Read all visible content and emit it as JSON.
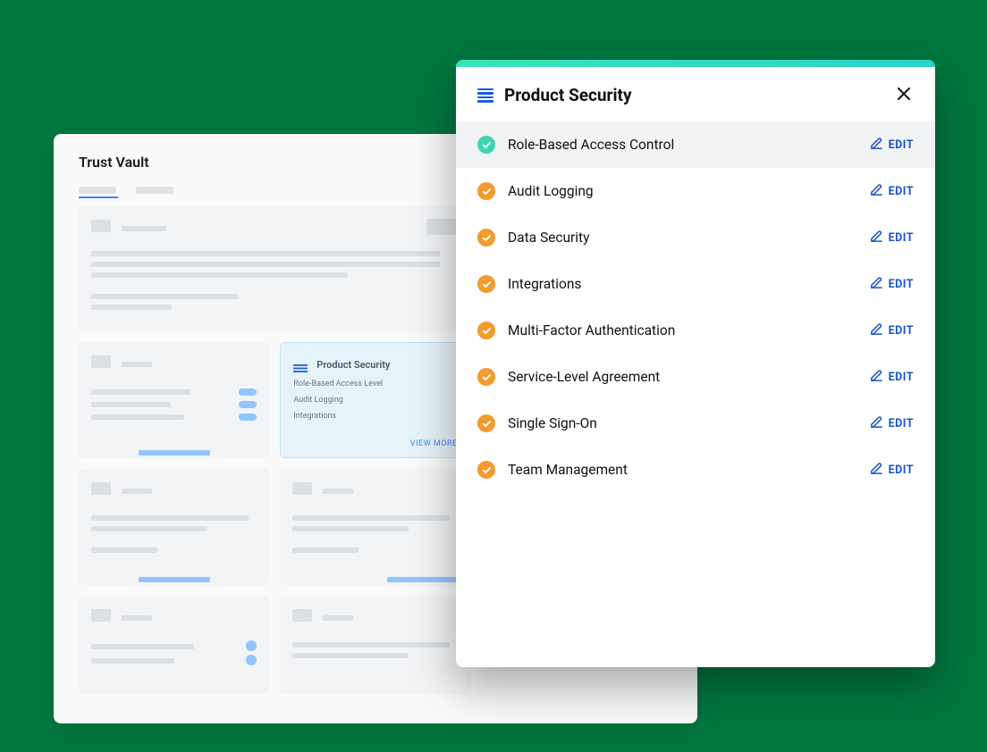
{
  "background": {
    "title": "Trust Vault",
    "product_security_card": {
      "title": "Product Security",
      "lines": [
        "Role-Based Access Level",
        "Audit Logging",
        "Integrations"
      ],
      "view_more": "VIEW MORE"
    }
  },
  "panel": {
    "title": "Product Security",
    "edit_label": "EDIT",
    "items": [
      {
        "label": "Role-Based Access Control",
        "status": "green",
        "highlight": true
      },
      {
        "label": "Audit Logging",
        "status": "orange",
        "highlight": false
      },
      {
        "label": "Data Security",
        "status": "orange",
        "highlight": false
      },
      {
        "label": "Integrations",
        "status": "orange",
        "highlight": false
      },
      {
        "label": "Multi-Factor Authentication",
        "status": "orange",
        "highlight": false
      },
      {
        "label": "Service-Level Agreement",
        "status": "orange",
        "highlight": false
      },
      {
        "label": "Single Sign-On",
        "status": "orange",
        "highlight": false
      },
      {
        "label": "Team Management",
        "status": "orange",
        "highlight": false
      }
    ]
  }
}
